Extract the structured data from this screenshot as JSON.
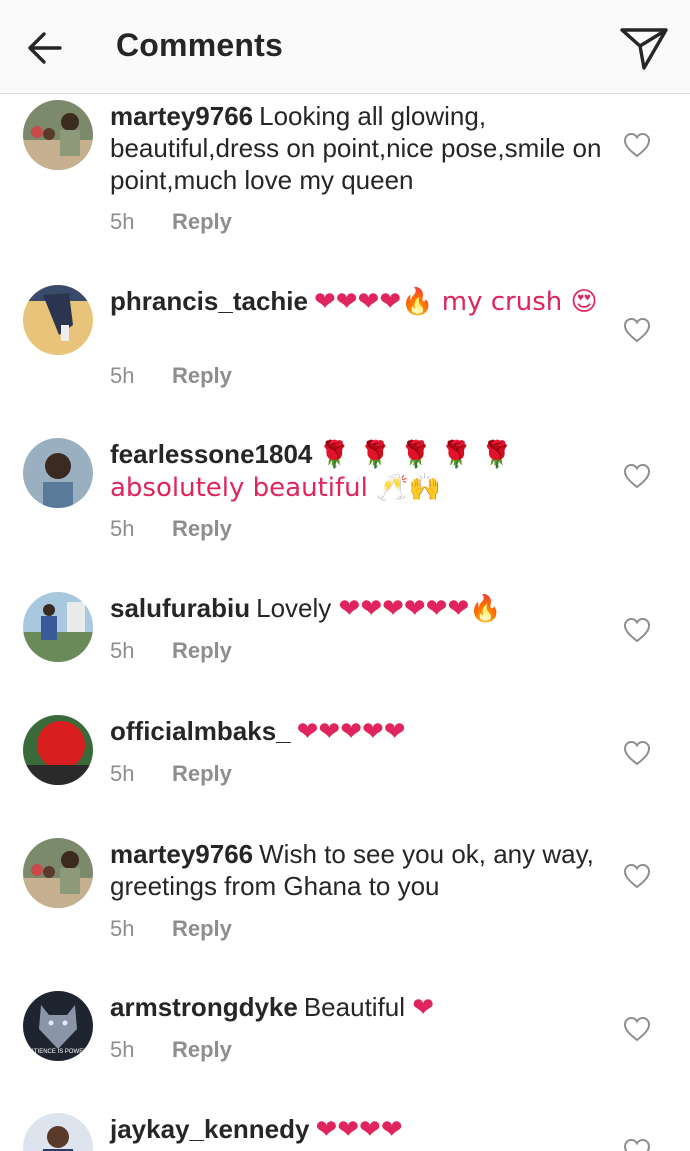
{
  "header": {
    "title": "Comments",
    "back_icon": "arrow-left-icon",
    "share_icon": "paper-plane-icon"
  },
  "colors": {
    "text": "#262626",
    "meta": "#8e8e8e",
    "header_bg": "#fafafa",
    "heart": "#e0245e"
  },
  "comments": [
    {
      "username": "martey9766",
      "text": "Looking all glowing, beautiful,dress on point,nice pose,smile on point,much love my queen",
      "emojis": "",
      "time": "5h",
      "reply": "Reply"
    },
    {
      "username": "phrancis_tachie",
      "text": "",
      "emojis": "❤❤❤❤🔥 my crush 😍",
      "time": "5h",
      "reply": "Reply"
    },
    {
      "username": "fearlessone1804",
      "text": "",
      "emojis": "🌹 🌹 🌹 🌹 🌹 absolutely beautiful 🥂🙌",
      "time": "5h",
      "reply": "Reply"
    },
    {
      "username": "salufurabiu",
      "text": "Lovely",
      "emojis": "❤❤❤❤❤❤🔥",
      "time": "5h",
      "reply": "Reply"
    },
    {
      "username": "officialmbaks_",
      "text": "",
      "emojis": "❤❤❤❤❤",
      "time": "5h",
      "reply": "Reply"
    },
    {
      "username": "martey9766",
      "text": "Wish to see you ok, any way, greetings from Ghana to you",
      "emojis": "",
      "time": "5h",
      "reply": "Reply"
    },
    {
      "username": "armstrongdyke",
      "text": "Beautiful",
      "emojis": "❤",
      "time": "5h",
      "reply": "Reply"
    },
    {
      "username": "jaykay_kennedy",
      "text": "",
      "emojis": "❤❤❤❤",
      "time": "",
      "reply": ""
    }
  ],
  "avatars": {
    "armstrongdyke_text": "PATIENCE IS POWER."
  }
}
